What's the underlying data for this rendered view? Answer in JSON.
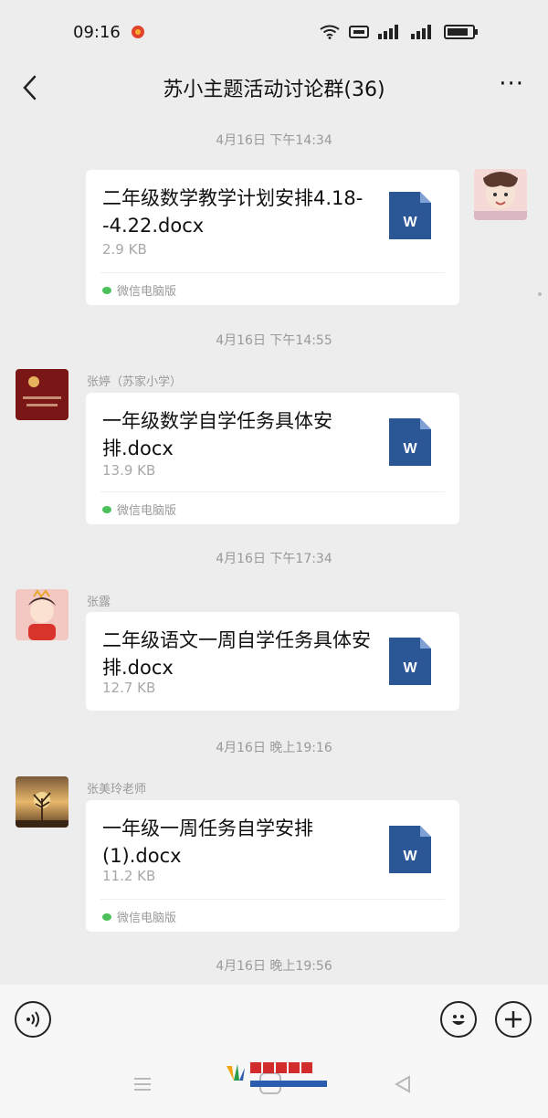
{
  "status_bar": {
    "time": "09:16"
  },
  "header": {
    "title": "苏小主题活动讨论群(36)",
    "more": "···"
  },
  "messages": [
    {
      "timestamp": "4月16日 下午14:34",
      "sender": "",
      "file_name": "二年级数学教学计划安排4.18--4.22.docx",
      "file_size": "2.9 KB",
      "source": "微信电脑版",
      "outgoing": true
    },
    {
      "timestamp": "4月16日 下午14:55",
      "sender": "张婷（苏家小学）",
      "file_name": "一年级数学自学任务具体安排.docx",
      "file_size": "13.9 KB",
      "source": "微信电脑版",
      "outgoing": false
    },
    {
      "timestamp": "4月16日 下午17:34",
      "sender": "张露",
      "file_name": "二年级语文一周自学任务具体安排.docx",
      "file_size": "12.7 KB",
      "source": "",
      "outgoing": false
    },
    {
      "timestamp": "4月16日 晚上19:16",
      "sender": "张美玲老师",
      "file_name": "一年级一周任务自学安排(1).docx",
      "file_size": "11.2 KB",
      "source": "微信电脑版",
      "outgoing": false
    }
  ],
  "last_timestamp": "4月16日 晚上19:56",
  "file_icon_letter": "W",
  "colors": {
    "word_blue": "#2b5797",
    "wechat_green": "#4cc15b",
    "background": "#ededed"
  },
  "icons": {
    "back": "chevron-left-icon",
    "more": "more-dots-icon",
    "voice": "voice-icon",
    "emoji": "emoji-icon",
    "add": "plus-icon",
    "file": "word-document-icon"
  }
}
